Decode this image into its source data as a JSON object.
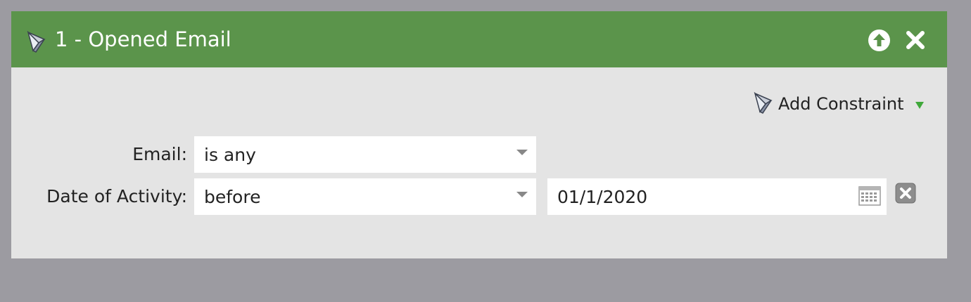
{
  "header": {
    "title": "1 - Opened Email",
    "color": "#5b944b"
  },
  "toolbar": {
    "add_constraint_label": "Add Constraint"
  },
  "filters": {
    "email": {
      "label": "Email:",
      "operator": "is any"
    },
    "date_of_activity": {
      "label": "Date of Activity:",
      "operator": "before",
      "date_value": "01/1/2020"
    }
  },
  "icons": {
    "header": "funnel-icon",
    "move_up": "arrow-up-circle-icon",
    "close": "close-icon",
    "add_constraint": "funnel-icon",
    "dropdown": "caret-down-icon",
    "calendar": "calendar-icon",
    "clear": "clear-x-icon"
  }
}
